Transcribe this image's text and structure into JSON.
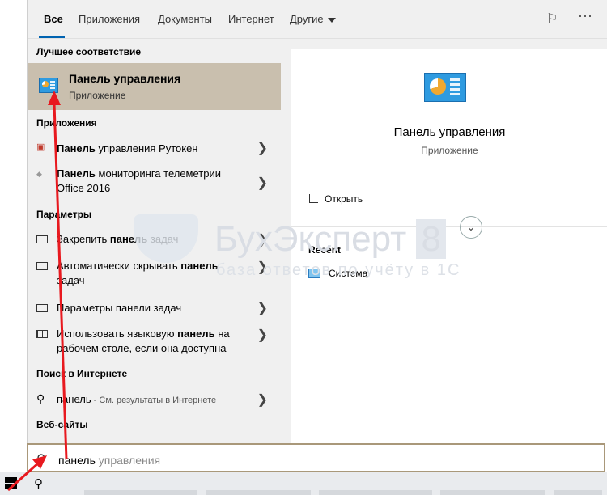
{
  "tabs": [
    "Все",
    "Приложения",
    "Документы",
    "Интернет",
    "Другие"
  ],
  "sections": {
    "best": "Лучшее соответствие",
    "apps": "Приложения",
    "params": "Параметры",
    "web_search": "Поиск в Интернете",
    "websites": "Веб-сайты"
  },
  "best_match": {
    "title": "Панель управления",
    "subtitle": "Приложение"
  },
  "apps": [
    {
      "bold": "Панель",
      "rest": " управления Рутокен"
    },
    {
      "bold": "Панель",
      "rest": " мониторинга телеметрии",
      "line2": "Office 2016"
    }
  ],
  "params": [
    {
      "pre": "Закрепить ",
      "bold": "панель",
      "rest": " задач"
    },
    {
      "pre": "Автоматически скрывать ",
      "bold": "панель",
      "line2": "задач"
    },
    {
      "pre": "Параметры панели задач"
    },
    {
      "pre": "Использовать языковую ",
      "bold": "панель",
      "rest": " на",
      "line2": "рабочем столе, если она доступна"
    }
  ],
  "web": {
    "term": "панель",
    "suffix": " - См. результаты в Интернете"
  },
  "preview": {
    "title": "Панель управления",
    "subtitle": "Приложение",
    "open": "Открыть",
    "recent": "Recent",
    "recent_item": "Система"
  },
  "search": {
    "typed": "панель",
    "suggest": " управления"
  },
  "watermark": {
    "line1": "БухЭксперт",
    "badge": "8",
    "line2": "базa ответов по учёту в 1С"
  },
  "icons": {
    "more": "ellipsis-icon",
    "feedback": "feedback-icon",
    "chevron": "chevron-right-icon",
    "search": "search-icon",
    "windows": "windows-icon"
  },
  "colors": {
    "accent": "#0063b1",
    "highlight": "#c9bfae",
    "arrow": "#e8191f"
  }
}
